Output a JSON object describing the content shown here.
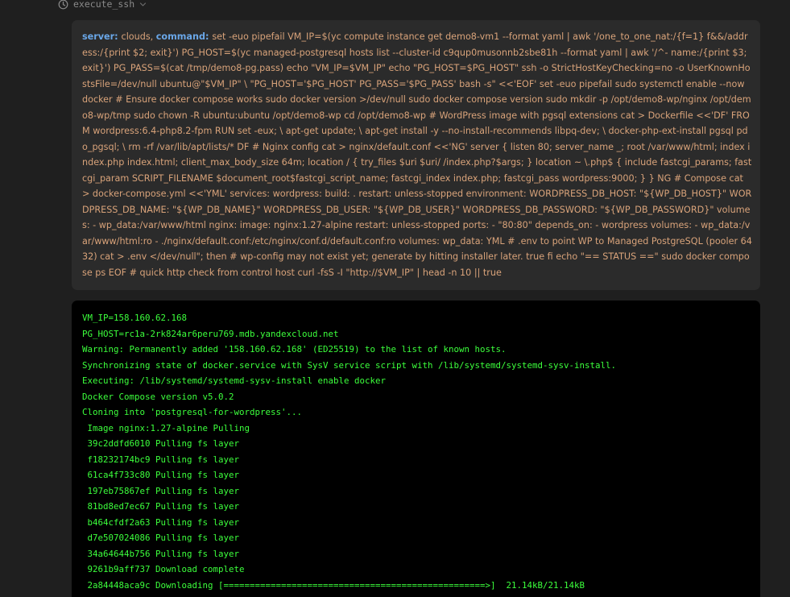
{
  "tool": {
    "name": "execute_ssh",
    "clock_icon": "clock-icon",
    "expand_icon": "chevron-down-icon"
  },
  "command": {
    "server_label": "server",
    "server_value": "clouds",
    "command_label": "command",
    "text": "set -euo pipefail VM_IP=$(yc compute instance get demo8-vm1 --format yaml | awk '/one_to_one_nat:/{f=1} f&&/address:/{print $2; exit}') PG_HOST=$(yc managed-postgresql hosts list --cluster-id c9qup0musonnb2sbe81h --format yaml | awk '/^- name:/{print $3; exit}') PG_PASS=$(cat /tmp/demo8-pg.pass) echo \"VM_IP=$VM_IP\" echo \"PG_HOST=$PG_HOST\" ssh -o StrictHostKeyChecking=no -o UserKnownHostsFile=/dev/null ubuntu@\"$VM_IP\" \\ \"PG_HOST='$PG_HOST' PG_PASS='$PG_PASS' bash -s\" <<'EOF' set -euo pipefail sudo systemctl enable --now docker # Ensure docker compose works sudo docker version >/dev/null sudo docker compose version sudo mkdir -p /opt/demo8-wp/nginx /opt/demo8-wp/tmp sudo chown -R ubuntu:ubuntu /opt/demo8-wp cd /opt/demo8-wp # WordPress image with pgsql extensions cat > Dockerfile <<'DF' FROM wordpress:6.4-php8.2-fpm RUN set -eux; \\ apt-get update; \\ apt-get install -y --no-install-recommends libpq-dev; \\ docker-php-ext-install pgsql pdo_pgsql; \\ rm -rf /var/lib/apt/lists/* DF # Nginx config cat > nginx/default.conf <<'NG' server { listen 80; server_name _; root /var/www/html; index index.php index.html; client_max_body_size 64m; location / { try_files $uri $uri/ /index.php?$args; } location ~ \\.php$ { include fastcgi_params; fastcgi_param SCRIPT_FILENAME $document_root$fastcgi_script_name; fastcgi_index index.php; fastcgi_pass wordpress:9000; } } NG # Compose cat > docker-compose.yml <<'YML' services: wordpress: build: . restart: unless-stopped environment: WORDPRESS_DB_HOST: \"${WP_DB_HOST}\" WORDPRESS_DB_NAME: \"${WP_DB_NAME}\" WORDPRESS_DB_USER: \"${WP_DB_USER}\" WORDPRESS_DB_PASSWORD: \"${WP_DB_PASSWORD}\" volumes: - wp_data:/var/www/html nginx: image: nginx:1.27-alpine restart: unless-stopped ports: - \"80:80\" depends_on: - wordpress volumes: - wp_data:/var/www/html:ro - ./nginx/default.conf:/etc/nginx/conf.d/default.conf:ro volumes: wp_data: YML # .env to point WP to Managed PostgreSQL (pooler 6432) cat > .env </dev/null\"; then # wp-config may not exist yet; generate by hitting installer later. true fi echo \"== STATUS ==\" sudo docker compose ps EOF # quick http check from control host curl -fsS -I \"http://$VM_IP\" | head -n 10 || true"
  },
  "output": {
    "lines": [
      "VM_IP=158.160.62.168",
      "PG_HOST=rc1a-2rk824ar6peru769.mdb.yandexcloud.net",
      "Warning: Permanently added '158.160.62.168' (ED25519) to the list of known hosts.",
      "Synchronizing state of docker.service with SysV service script with /lib/systemd/systemd-sysv-install.",
      "Executing: /lib/systemd/systemd-sysv-install enable docker",
      "Docker Compose version v5.0.2",
      "Cloning into 'postgresql-for-wordpress'...",
      " Image nginx:1.27-alpine Pulling",
      " 39c2ddfd6010 Pulling fs layer",
      " f18232174bc9 Pulling fs layer",
      " 61ca4f733c80 Pulling fs layer",
      " 197eb75867ef Pulling fs layer",
      " 81bd8ed7ec67 Pulling fs layer",
      " b464cfdf2a63 Pulling fs layer",
      " d7e507024086 Pulling fs layer",
      " 34a64644b756 Pulling fs layer",
      " 9261b9aff737 Download complete",
      " 2a84448aca9c Downloading [==================================================>]  21.14kB/21.14kB"
    ]
  },
  "colors": {
    "background": "#1f1f1f",
    "command_card": "#2b2b2b",
    "command_text": "#d9a37a",
    "command_key": "#6aa7e8",
    "terminal_background": "#000000",
    "terminal_text": "#3cff3c"
  }
}
